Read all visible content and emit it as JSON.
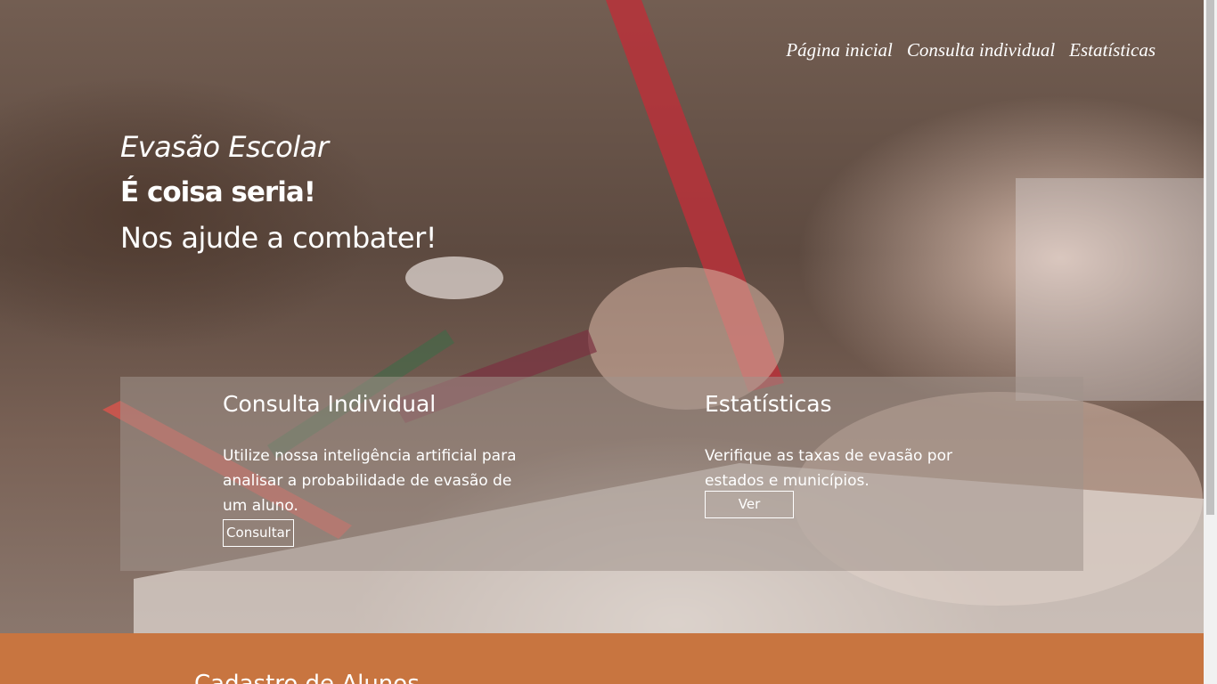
{
  "nav": {
    "items": [
      {
        "label": "Página inicial"
      },
      {
        "label": "Consulta individual"
      },
      {
        "label": "Estatísticas"
      }
    ]
  },
  "hero": {
    "line1": "Evasão Escolar",
    "line2": "É coisa seria!",
    "line3": "Nos ajude a combater!"
  },
  "cards": {
    "consulta": {
      "title": "Consulta Individual",
      "text": "Utilize nossa inteligência artificial para analisar a probabilidade de evasão de um aluno.",
      "button": "Consultar"
    },
    "estatisticas": {
      "title": "Estatísticas",
      "text": "Verifique as taxas de evasão por estados e municípios.",
      "button": "Ver"
    }
  },
  "section2": {
    "title": "Cadastro de Alunos"
  },
  "colors": {
    "accent_section": "#c87540",
    "panel": "#a0948c"
  }
}
